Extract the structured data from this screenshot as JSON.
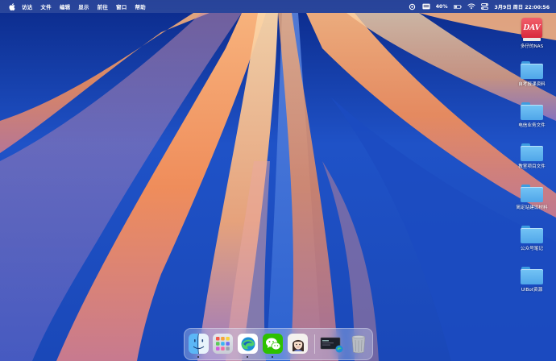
{
  "menubar": {
    "items": [
      "访达",
      "文件",
      "编辑",
      "显示",
      "前往",
      "窗口",
      "帮助"
    ],
    "battery_percent": "40%",
    "datetime": "3月9日 周日 22:00:56",
    "icons": [
      "apple-logo-icon",
      "display-icon",
      "battery-icon",
      "wifi-icon",
      "search-icon",
      "control-center-icon"
    ]
  },
  "desktop": {
    "items": [
      {
        "label": "多仔的NAS",
        "icon": "nas-drive-icon",
        "badge_text": "DAV"
      },
      {
        "label": "自考报课资料",
        "icon": "folder-icon"
      },
      {
        "label": "电信业务文件",
        "icon": "folder-icon"
      },
      {
        "label": "教室项目文件",
        "icon": "folder-icon"
      },
      {
        "label": "简定站建设材料",
        "icon": "folder-icon"
      },
      {
        "label": "公众号笔记",
        "icon": "folder-icon"
      },
      {
        "label": "UIBot资源",
        "icon": "folder-icon"
      }
    ]
  },
  "dock": {
    "apps": [
      {
        "name": "finder",
        "icon": "finder-icon",
        "running": true
      },
      {
        "name": "launchpad",
        "icon": "launchpad-icon",
        "running": false
      },
      {
        "name": "edge",
        "icon": "edge-browser-icon",
        "running": true
      },
      {
        "name": "wechat",
        "icon": "wechat-icon",
        "running": true
      },
      {
        "name": "avatar-app",
        "icon": "avatar-app-icon",
        "running": false
      },
      {
        "name": "recent-window",
        "icon": "window-thumbnail-icon",
        "running": false
      },
      {
        "name": "trash",
        "icon": "trash-icon",
        "running": false
      }
    ]
  },
  "colors": {
    "wallpaper_blue": "#1d4fc6",
    "wallpaper_orange": "#f19a62",
    "folder_blue": "#5fb3ef",
    "wechat_green": "#2dc100"
  }
}
